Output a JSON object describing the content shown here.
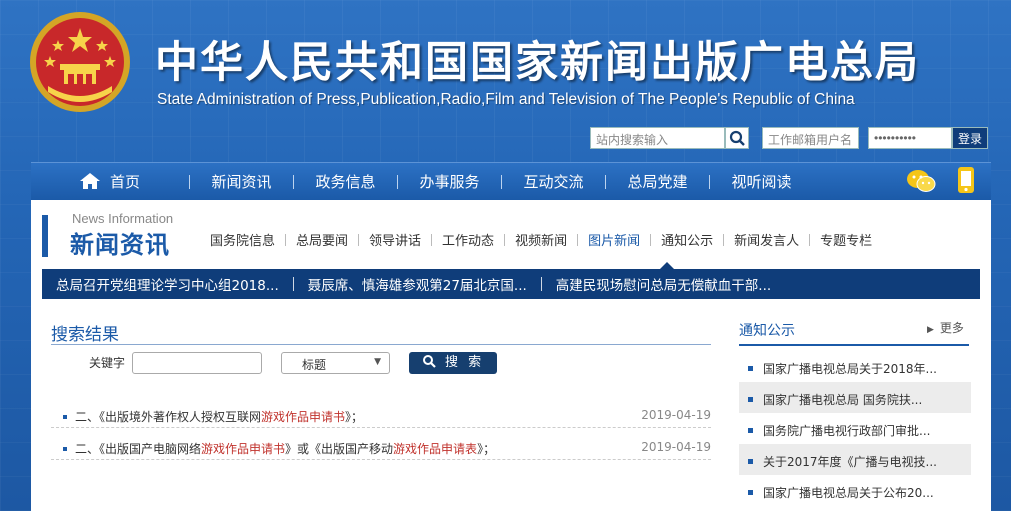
{
  "header": {
    "title": "中华人民共和国国家新闻出版广电总局",
    "subtitle": "State Administration of Press,Publication,Radio,Film and Television of The People's Republic of China"
  },
  "login": {
    "search_placeholder": "站内搜索输入",
    "user_placeholder": "工作邮箱用户名",
    "password_value": "••••••••••",
    "login_label": "登录"
  },
  "nav": {
    "items": [
      "首页",
      "新闻资讯",
      "政务信息",
      "办事服务",
      "互动交流",
      "总局党建",
      "视听阅读"
    ]
  },
  "news": {
    "en": "News Information",
    "cn": "新闻资讯",
    "subnav": [
      "国务院信息",
      "总局要闻",
      "领导讲话",
      "工作动态",
      "视频新闻",
      "图片新闻",
      "通知公示",
      "新闻发言人",
      "专题专栏"
    ],
    "active_index": 5
  },
  "ticker": [
    "总局召开党组理论学习中心组2018...",
    "聂辰席、慎海雄参观第27届北京国...",
    "高建民现场慰问总局无偿献血干部..."
  ],
  "search": {
    "title": "搜索结果",
    "keyword_label": "关键字",
    "keyword_value": "",
    "select_value": "标题",
    "button_label": "搜 索"
  },
  "results": [
    {
      "pre": "二、《出版境外著作权人授权互联网",
      "hl": "游戏作品申请书",
      "post": "》；",
      "date": "2019-04-19"
    },
    {
      "pre": "二、《出版国产电脑网络",
      "hl": "游戏作品申请书",
      "mid": "》或《出版国产移动",
      "hl2": "游戏作品申请表",
      "post": "》；",
      "date": "2019-04-19"
    }
  ],
  "side": {
    "title": "通知公示",
    "more": "更多",
    "items": [
      "国家广播电视总局关于2018年...",
      "国家广播电视总局 国务院扶...",
      "国务院广播电视行政部门审批...",
      "关于2017年度《广播与电视技...",
      "国家广播电视总局关于公布20..."
    ]
  },
  "colors": {
    "brand_blue": "#1b5aa8",
    "dark_blue": "#0f3d7a",
    "highlight_red": "#c0322c"
  }
}
